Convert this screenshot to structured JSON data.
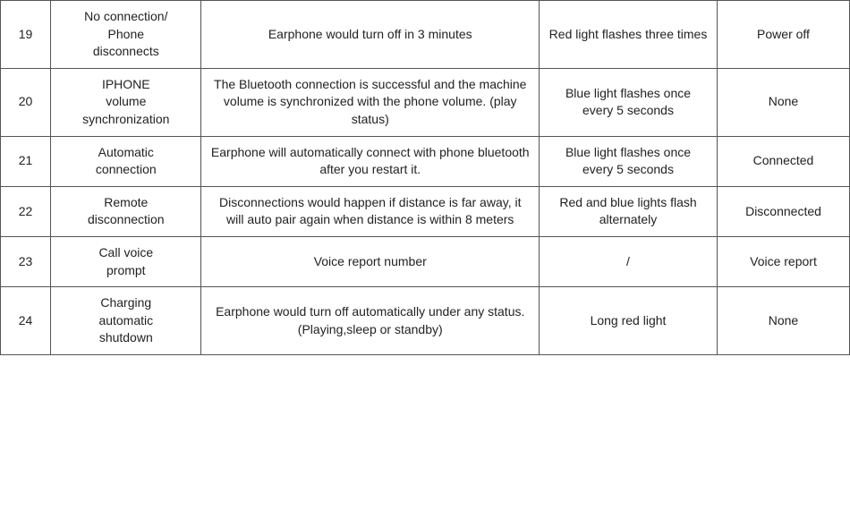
{
  "rows": [
    {
      "num": "19",
      "name": "No connection/\nPhone\ndisconnects",
      "description": "Earphone would turn off in 3 minutes",
      "indicator": "Red light flashes three times",
      "status": "Power off"
    },
    {
      "num": "20",
      "name": "IPHONE\nvolume\nsynchronization",
      "description": "The Bluetooth connection is successful and the machine volume is synchronized with the phone volume. (play status)",
      "indicator": "Blue light flashes once every 5 seconds",
      "status": "None"
    },
    {
      "num": "21",
      "name": "Automatic\nconnection",
      "description": "Earphone will automatically connect with phone bluetooth after you restart it.",
      "indicator": "Blue light flashes once every 5 seconds",
      "status": "Connected"
    },
    {
      "num": "22",
      "name": "Remote\ndisconnection",
      "description": "Disconnections would happen if distance is far away, it will auto pair again when distance is within 8 meters",
      "indicator": "Red and blue lights flash alternately",
      "status": "Disconnected"
    },
    {
      "num": "23",
      "name": "Call voice\nprompt",
      "description": "Voice report number",
      "indicator": "/",
      "status": "Voice report"
    },
    {
      "num": "24",
      "name": "Charging\nautomatic\nshutdown",
      "description": "Earphone would turn off automatically under any status.(Playing,sleep or standby)",
      "indicator": "Long red light",
      "status": "None"
    }
  ]
}
